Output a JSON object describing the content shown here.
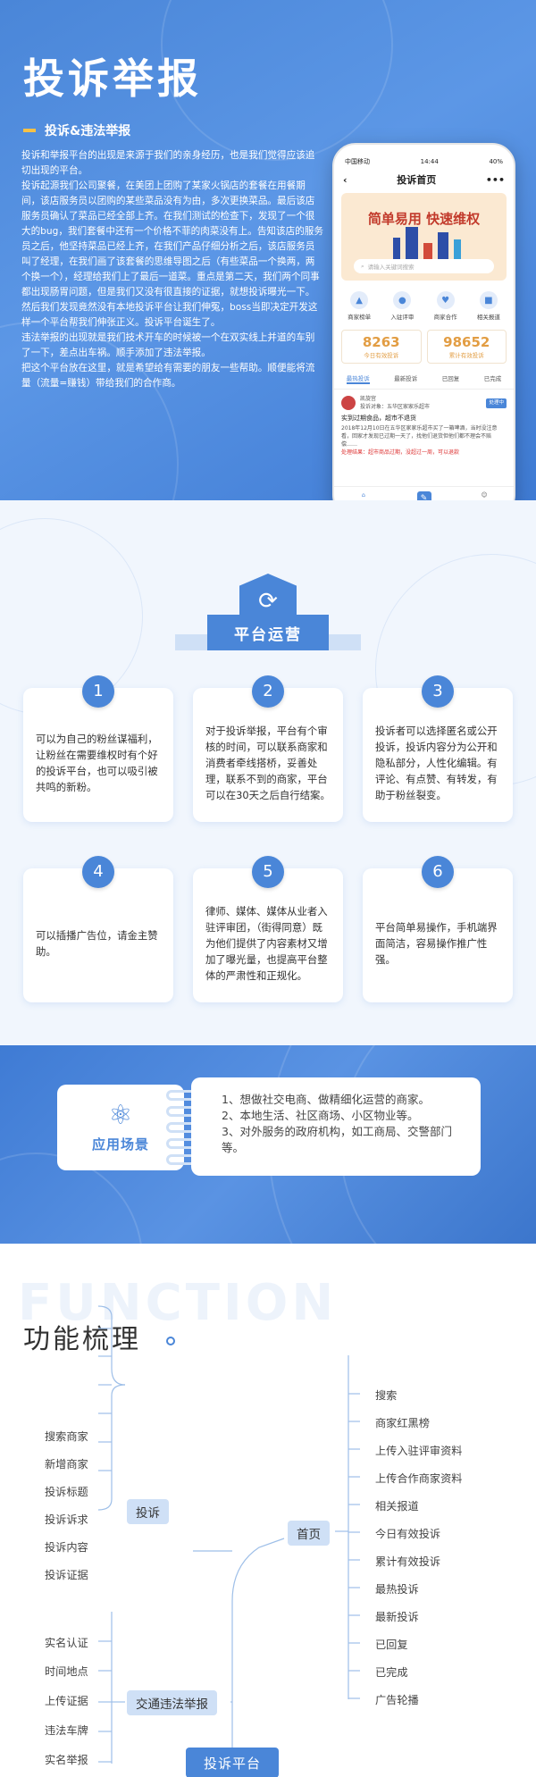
{
  "hero": {
    "title": "投诉举报",
    "subtitle": "投诉&违法举报",
    "paragraphs": [
      "投诉和举报平台的出现是来源于我们的亲身经历，也是我们觉得应该追切出现的平台。",
      "投诉起源我们公司聚餐，在美团上团购了某家火锅店的套餐在用餐期间，该店服务员以团购的某些菜品没有为由，多次更换菜品。最后该店服务员确认了菜品已经全部上齐。在我们测试的检查下，发现了一个很大的bug，我们套餐中还有一个价格不菲的肉菜没有上。告知该店的服务员之后，他坚持菜品已经上齐，在我们产品仔细分析之后，该店服务员叫了经理，在我们画了该套餐的思维导图之后（有些菜品一个换两，两个换一个），经理给我们上了最后一道菜。重点是第二天，我们两个同事都出现肠胃问题，但是我们又没有很直接的证据，就想投诉曝光一下。然后我们发现竟然没有本地投诉平台让我们伸冤，boss当即决定开发这样一个平台帮我们伸张正义。投诉平台诞生了。",
      "违法举报的出现就是我们技术开车的时候被一个在双实线上并道的车别了一下，差点出车祸。顺手添加了违法举报。",
      "把这个平台放在这里，就是希望给有需要的朋友一些帮助。顺便能将流量（流量=赚钱）带给我们的合作商。"
    ]
  },
  "phone": {
    "carrier": "中国移动",
    "time": "14:44",
    "battery": "40%",
    "title": "投诉首页",
    "banner_slogan": "简单易用 快速维权",
    "search_placeholder": "请输入关键词搜索",
    "icons": [
      {
        "label": "商家榜单",
        "icon": "shop-icon"
      },
      {
        "label": "入驻评审",
        "icon": "user-icon"
      },
      {
        "label": "商家合作",
        "icon": "handshake-icon"
      },
      {
        "label": "相关报道",
        "icon": "news-icon"
      }
    ],
    "stats": [
      {
        "value": "8263",
        "label": "今日有效投诉"
      },
      {
        "value": "98652",
        "label": "累计有效投诉"
      }
    ],
    "tabs": [
      "最热投诉",
      "最新投诉",
      "已回复",
      "已完成"
    ],
    "post": {
      "user": "凯旋宫",
      "target": "投诉对象：五华区家家乐超市",
      "badge": "处理中",
      "title": "实到过期食品，超市不退货",
      "body": "2018年12月10日在五华区家家乐超市买了一箱啤酒，当时没注意看，回家才发现已过期一天了，找他们退货但他们都不理会不赔偿……",
      "fix": "处理结果：超市商品过期，没超过一周，可以退款"
    },
    "bottom": [
      "首页",
      "我的"
    ]
  },
  "ops": {
    "title": "平台运营",
    "cards": [
      {
        "n": "1",
        "text": "可以为自己的粉丝谋福利，让粉丝在需要维权时有个好的投诉平台，也可以吸引被共鸣的新粉。"
      },
      {
        "n": "2",
        "text": "对于投诉举报，平台有个审核的时间，可以联系商家和消费者牵线搭桥，妥善处理，联系不到的商家，平台可以在30天之后自行结案。"
      },
      {
        "n": "3",
        "text": "投诉者可以选择匿名或公开投诉，投诉内容分为公开和隐私部分，人性化编辑。有评论、有点赞、有转发，有助于粉丝裂变。"
      },
      {
        "n": "4",
        "text": "可以插播广告位，请金主赞助。"
      },
      {
        "n": "5",
        "text": "律师、媒体、媒体从业者入驻评审团，（街得同意）既为他们提供了内容素材又增加了曝光量，也提高平台整体的严肃性和正规化。"
      },
      {
        "n": "6",
        "text": "平台简单易操作，手机端界面简洁，容易操作推广性强。"
      }
    ]
  },
  "scenes": {
    "label": "应用场景",
    "items": [
      "1、想做社交电商、做精细化运营的商家。",
      "2、本地生活、社区商场、小区物业等。",
      "3、对外服务的政府机构，如工商局、交警部门等。"
    ]
  },
  "function": {
    "bg_word": "FUNCTION",
    "title": "功能梳理",
    "root": "投诉平台",
    "node_tousu": "投诉",
    "node_weifa": "交通违法举报",
    "node_home": "首页",
    "tousu_items": [
      "搜索商家",
      "新增商家",
      "投诉标题",
      "投诉诉求",
      "投诉内容",
      "投诉证据"
    ],
    "weifa_items": [
      "实名认证",
      "时间地点",
      "上传证据",
      "违法车牌",
      "实名举报"
    ],
    "home_items": [
      "搜索",
      "商家红黑榜",
      "上传入驻评审资料",
      "上传合作商家资料",
      "相关报道",
      "今日有效投诉",
      "累计有效投诉",
      "最热投诉",
      "最新投诉",
      "已回复",
      "已完成",
      "广告轮播"
    ]
  }
}
